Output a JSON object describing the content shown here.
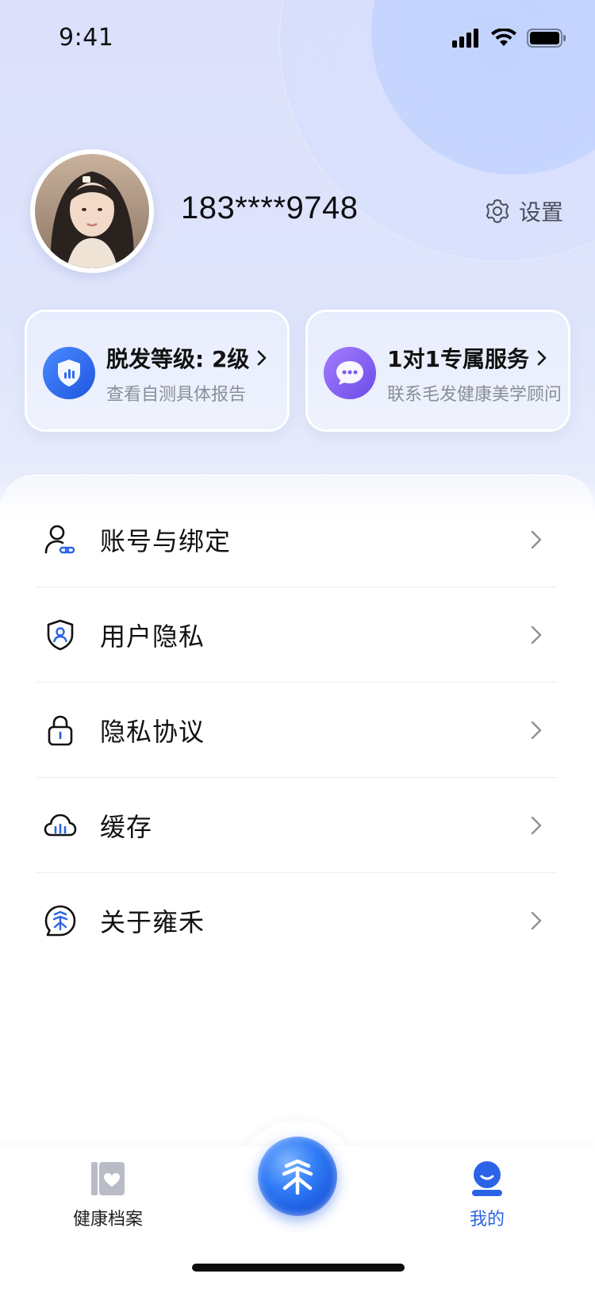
{
  "status_bar": {
    "time": "9:41"
  },
  "profile": {
    "phone": "183****9748",
    "settings_label": "设置"
  },
  "cards": [
    {
      "title": "脱发等级: 2级",
      "subtitle": "查看自测具体报告",
      "icon": "shield-chart-icon"
    },
    {
      "title": "1对1专属服务",
      "subtitle": "联系毛发健康美学顾问",
      "icon": "chat-bubble-icon"
    }
  ],
  "menu": {
    "items": [
      {
        "label": "账号与绑定",
        "icon": "user-link-icon"
      },
      {
        "label": "用户隐私",
        "icon": "shield-user-icon"
      },
      {
        "label": "隐私协议",
        "icon": "lock-icon"
      },
      {
        "label": "缓存",
        "icon": "cloud-bars-icon"
      },
      {
        "label": "关于雍禾",
        "icon": "brand-logo-icon"
      }
    ]
  },
  "tab_bar": {
    "left_label": "健康档案",
    "right_label": "我的",
    "active": "我的"
  },
  "colors": {
    "accent": "#2b63e6",
    "card_icon_blue": "#2f6bf0",
    "card_icon_purple": "#8b63f2"
  }
}
